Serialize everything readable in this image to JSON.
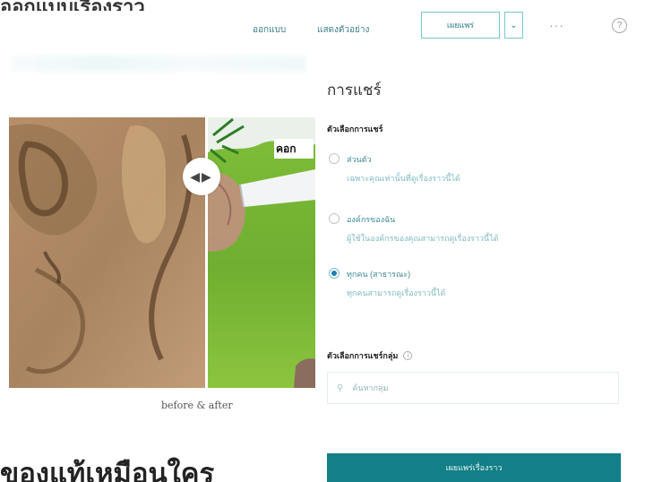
{
  "page": {
    "top_cut_title": "ออกแบบเรื่องราว",
    "bottom_heading": "ของแท้เหมือนใคร"
  },
  "toolbar": {
    "design_label": "ออกแบบ",
    "preview_label": "แสดงตัวอย่าง",
    "publish_label": "เผยแพร่",
    "caret_icon": "chevron-down-icon",
    "more_label": "···",
    "help_label": "?"
  },
  "before_after": {
    "caption": "before & after",
    "tag_text": "คอก",
    "handle_glyph": "◀▶"
  },
  "share_panel": {
    "title": "การแชร์",
    "visibility_label": "ตัวเลือกการแชร์",
    "options": [
      {
        "label": "ส่วนตัว",
        "desc": "เฉพาะคุณเท่านั้นที่ดูเรื่องราวนี้ได้",
        "selected": false
      },
      {
        "label": "องค์กรของฉัน",
        "desc": "ผู้ใช้ในองค์กรของคุณสามารถดูเรื่องราวนี้ได้",
        "selected": false
      },
      {
        "label": "ทุกคน (สาธารณะ)",
        "desc": "ทุกคนสามารถดูเรื่องราวนี้ได้",
        "selected": true
      }
    ],
    "group_label": "ตัวเลือกการแชร์กลุ่ม",
    "group_search_placeholder": "ค้นหากลุ่ม",
    "publish_button": "เผยแพร่เรื่องราว"
  },
  "colors": {
    "accent": "#137f86",
    "link": "#3e7f86",
    "radio_selected": "#1a7fb5"
  }
}
